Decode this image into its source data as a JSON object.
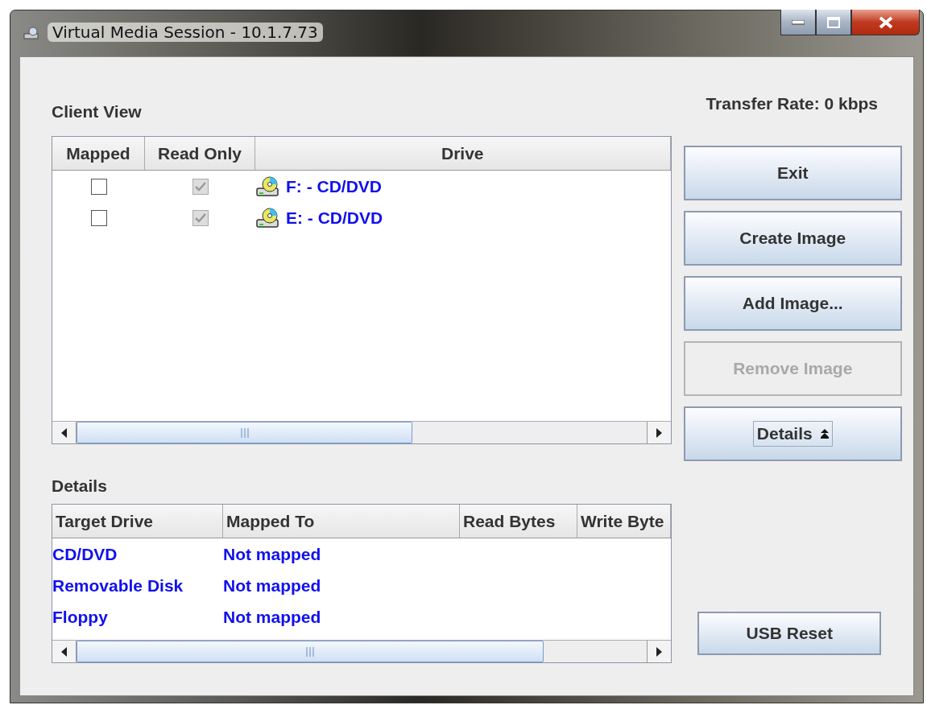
{
  "window": {
    "title": "Virtual Media Session - 10.1.7.73"
  },
  "transfer_rate": "Transfer Rate:  0 kbps",
  "client_view": {
    "title": "Client View",
    "columns": [
      "Mapped",
      "Read Only",
      "Drive"
    ],
    "rows": [
      {
        "mapped": false,
        "read_only": true,
        "read_only_disabled": true,
        "drive": "F: - CD/DVD"
      },
      {
        "mapped": false,
        "read_only": true,
        "read_only_disabled": true,
        "drive": "E: - CD/DVD"
      }
    ]
  },
  "buttons": [
    {
      "label": "Exit",
      "kind": "plain",
      "disabled": false
    },
    {
      "label": "Create Image",
      "kind": "plain",
      "disabled": false
    },
    {
      "label": "Add Image...",
      "kind": "plain",
      "disabled": false
    },
    {
      "label": "Remove Image",
      "kind": "plain",
      "disabled": true
    },
    {
      "label": "Details",
      "kind": "toggle",
      "disabled": false
    }
  ],
  "details": {
    "title": "Details",
    "columns": [
      "Target Drive",
      "Mapped To",
      "Read Bytes",
      "Write Byte"
    ],
    "rows": [
      {
        "target": "CD/DVD",
        "mapped_to": "Not mapped"
      },
      {
        "target": "Removable Disk",
        "mapped_to": "Not mapped"
      },
      {
        "target": "Floppy",
        "mapped_to": "Not mapped"
      }
    ]
  },
  "usb_reset": {
    "label": "USB Reset",
    "disabled": false
  }
}
